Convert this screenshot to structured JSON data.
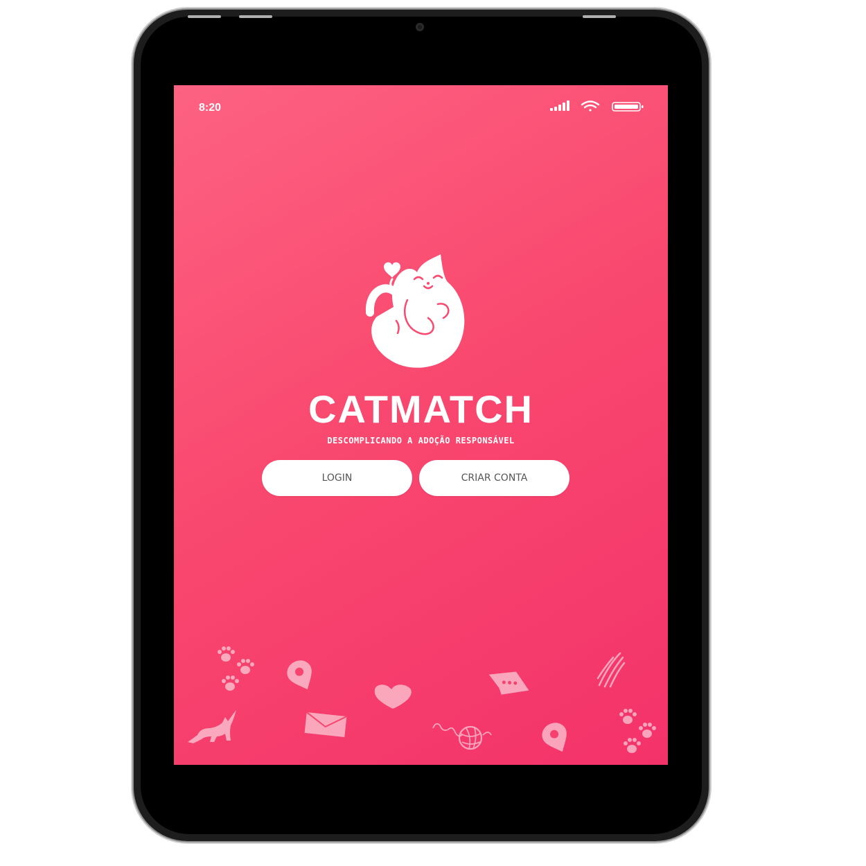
{
  "status_bar": {
    "time": "8:20",
    "icons": [
      "signal-icon",
      "wifi-icon",
      "battery-icon"
    ]
  },
  "app": {
    "name": "CATMATCH",
    "tagline": "DESCOMPLICANDO A ADOÇÃO RESPONSÁVEL",
    "logo": "cat-heart-logo"
  },
  "actions": {
    "login_label": "LOGIN",
    "create_account_label": "CRIAR CONTA"
  },
  "decorations": [
    "paw-icon",
    "location-pin-icon",
    "heart-icon",
    "chat-bubble-icon",
    "scratch-marks-icon",
    "cat-silhouette-icon",
    "envelope-icon",
    "yarn-ball-icon"
  ],
  "colors": {
    "background_start": "#fd6282",
    "background_end": "#f3326a",
    "button_bg": "#ffffff",
    "button_text": "#555555",
    "device_frame": "#1d1d1d"
  }
}
